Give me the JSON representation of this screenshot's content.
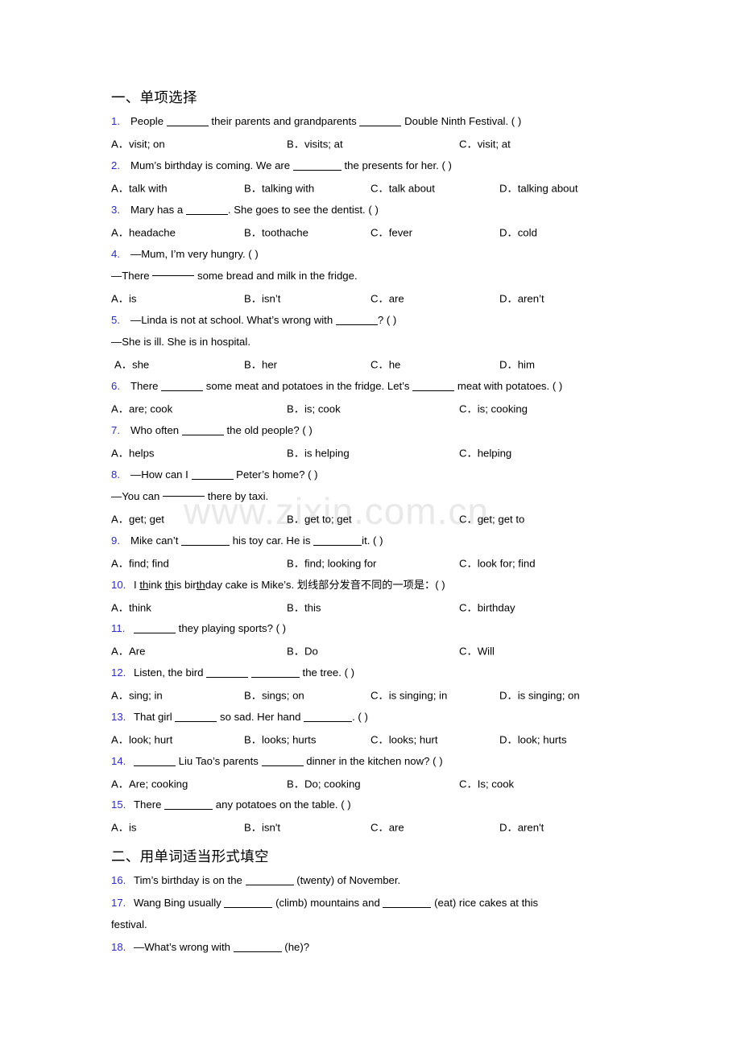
{
  "watermark": "www.zixin.com.cn",
  "colors": {
    "question_number": "#2a2ac8",
    "text": "#000000",
    "watermark": "#e9e9e9",
    "background": "#ffffff"
  },
  "sections": [
    {
      "id": "section-1",
      "header": "一、单项选择"
    },
    {
      "id": "section-2",
      "header": "二、用单词适当形式填空"
    }
  ],
  "questions": [
    {
      "num": "1.",
      "stem_a": "People",
      "stem_b": "their parents and grandparents",
      "stem_c": "Double Ninth Festival. (   )",
      "options": [
        "A．visit; on",
        "B．visits; at",
        "C．visit; at"
      ]
    },
    {
      "num": "2.",
      "stem_a": "Mum’s birthday is coming. We are",
      "stem_b": "the presents for her. (  )",
      "options": [
        "A．talk with",
        "B．talking with",
        "C．talk about",
        "D．talking about"
      ]
    },
    {
      "num": "3.",
      "stem_a": "Mary has a",
      "stem_b": ". She goes to see the dentist. (  )",
      "options": [
        "A．headache",
        "B．toothache",
        "C．fever",
        "D．cold"
      ]
    },
    {
      "num": "4.",
      "stem_a": "—Mum, I’m very hungry. (   )",
      "line2_a": "—There",
      "line2_b": "some bread and milk in the fridge.",
      "options": [
        "A．is",
        "B．isn’t",
        "C．are",
        "D．aren’t"
      ]
    },
    {
      "num": "5.",
      "stem_a": "—Linda is not at school. What’s wrong with",
      "stem_b": "? (  )",
      "line2": "—She is ill. She is in hospital.",
      "options": [
        "A．she",
        "B．her",
        "C．he",
        "D．him"
      ]
    },
    {
      "num": "6.",
      "stem_a": "There",
      "stem_b": "some meat and potatoes in the fridge. Let’s",
      "stem_c": "meat with potatoes. (   )",
      "options": [
        "A．are; cook",
        "B．is; cook",
        "C．is; cooking"
      ]
    },
    {
      "num": "7.",
      "stem_a": "Who often",
      "stem_b": "the old people? (  )",
      "options": [
        "A．helps",
        "B．is helping",
        "C．helping"
      ]
    },
    {
      "num": "8.",
      "stem_a": "—How can I",
      "stem_b": "Peter’s home? (  )",
      "line2_a": "—You can",
      "line2_b": "there by taxi.",
      "options": [
        "A．get; get",
        "B．get to; get",
        "C．get; get to"
      ]
    },
    {
      "num": "9.",
      "stem_a": "Mike can’t",
      "stem_b": "his toy car. He is",
      "stem_c": "it. (    )",
      "options": [
        "A．find; find",
        "B．find; looking for",
        "C．look for; find"
      ]
    },
    {
      "num": "10.",
      "stem_prefix": "I ",
      "stem_underlined_1": "th",
      "stem_mid_1": "ink ",
      "stem_underlined_2": "th",
      "stem_mid_2": "is bir",
      "stem_underlined_3": "th",
      "stem_suffix": "day cake is Mike’s. 划线部分发音不同的一项是：(    )",
      "options": [
        "A．think",
        "B．this",
        "C．birthday"
      ]
    },
    {
      "num": "11.",
      "stem_a": "",
      "stem_b": "they playing sports? (   )",
      "options": [
        "A．Are",
        "B．Do",
        "C．Will"
      ]
    },
    {
      "num": "12.",
      "stem_a": "Listen, the bird",
      "stem_b": "",
      "stem_c": "the tree. (  )",
      "options": [
        "A．sing; in",
        "B．sings; on",
        "C．is singing; in",
        "D．is singing; on"
      ]
    },
    {
      "num": "13.",
      "stem_a": "That girl",
      "stem_b": "so sad. Her hand",
      "stem_c": ". (  )",
      "options": [
        "A．look; hurt",
        "B．looks; hurts",
        "C．looks; hurt",
        "D．look; hurts"
      ]
    },
    {
      "num": "14.",
      "stem_a": "",
      "stem_b": "Liu Tao’s parents",
      "stem_c": "dinner in the kitchen now? (   )",
      "options": [
        "A．Are; cooking",
        "B．Do; cooking",
        "C．Is; cook"
      ]
    },
    {
      "num": "15.",
      "stem_a": "There",
      "stem_b": "any potatoes on the table. (  )",
      "options": [
        "A．is",
        "B．isn't",
        "C．are",
        "D．aren't"
      ]
    },
    {
      "num": "16.",
      "stem_a": "Tim’s birthday is on the",
      "stem_b": "(twenty) of November."
    },
    {
      "num": "17.",
      "stem_a": "Wang Bing usually",
      "stem_b": "(climb) mountains and",
      "stem_c": "(eat) rice cakes at this",
      "line2": "festival."
    },
    {
      "num": "18.",
      "stem_a": "—What’s wrong with",
      "stem_b": "(he)?"
    }
  ]
}
